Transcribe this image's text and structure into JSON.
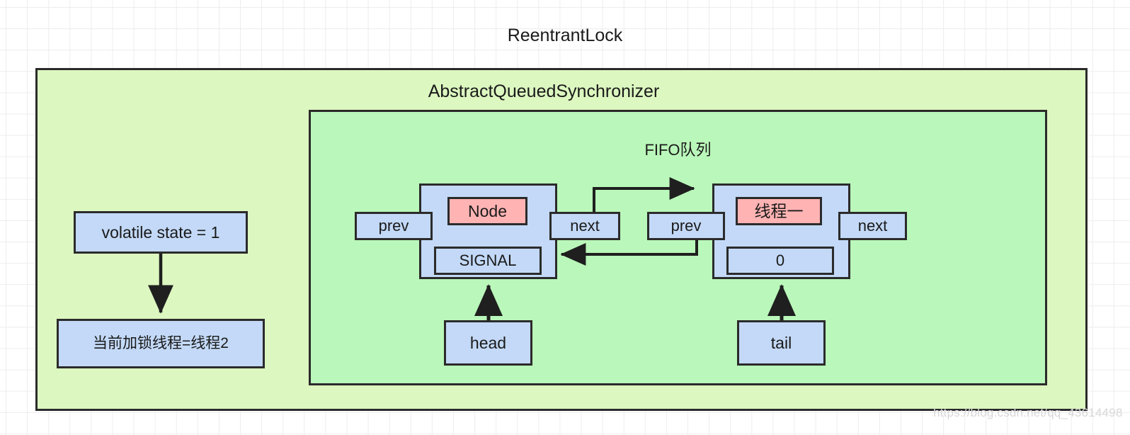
{
  "diagram": {
    "outer": {
      "title": "ReentrantLock"
    },
    "aqs": {
      "title": "AbstractQueuedSynchronizer",
      "fill": "#dcf7c0"
    },
    "fifo": {
      "title": "FIFO队列",
      "fill": "#baf7ba"
    },
    "left_panel": {
      "state_box": "volatile state = 1",
      "locked_thread_box": "当前加锁线程=线程2"
    },
    "node1": {
      "label": "Node",
      "waitstatus": "SIGNAL",
      "prev": "prev",
      "next": "next",
      "pointer": "head",
      "label_fill": "#ffb3b3",
      "body_fill": "#c3d9f7"
    },
    "node2": {
      "label": "线程一",
      "waitstatus": "0",
      "prev": "prev",
      "next": "next",
      "pointer": "tail",
      "label_fill": "#ffb3b3",
      "body_fill": "#c3d9f7"
    },
    "watermark": "https://blog.csdn.net/qq_43614498",
    "colors": {
      "stroke": "#2b2b2b",
      "grid": "#ededed",
      "blue": "#c3d9f7",
      "pink": "#ffb3b3",
      "green_outer": "#dcf7c0",
      "green_inner": "#baf7ba"
    }
  }
}
